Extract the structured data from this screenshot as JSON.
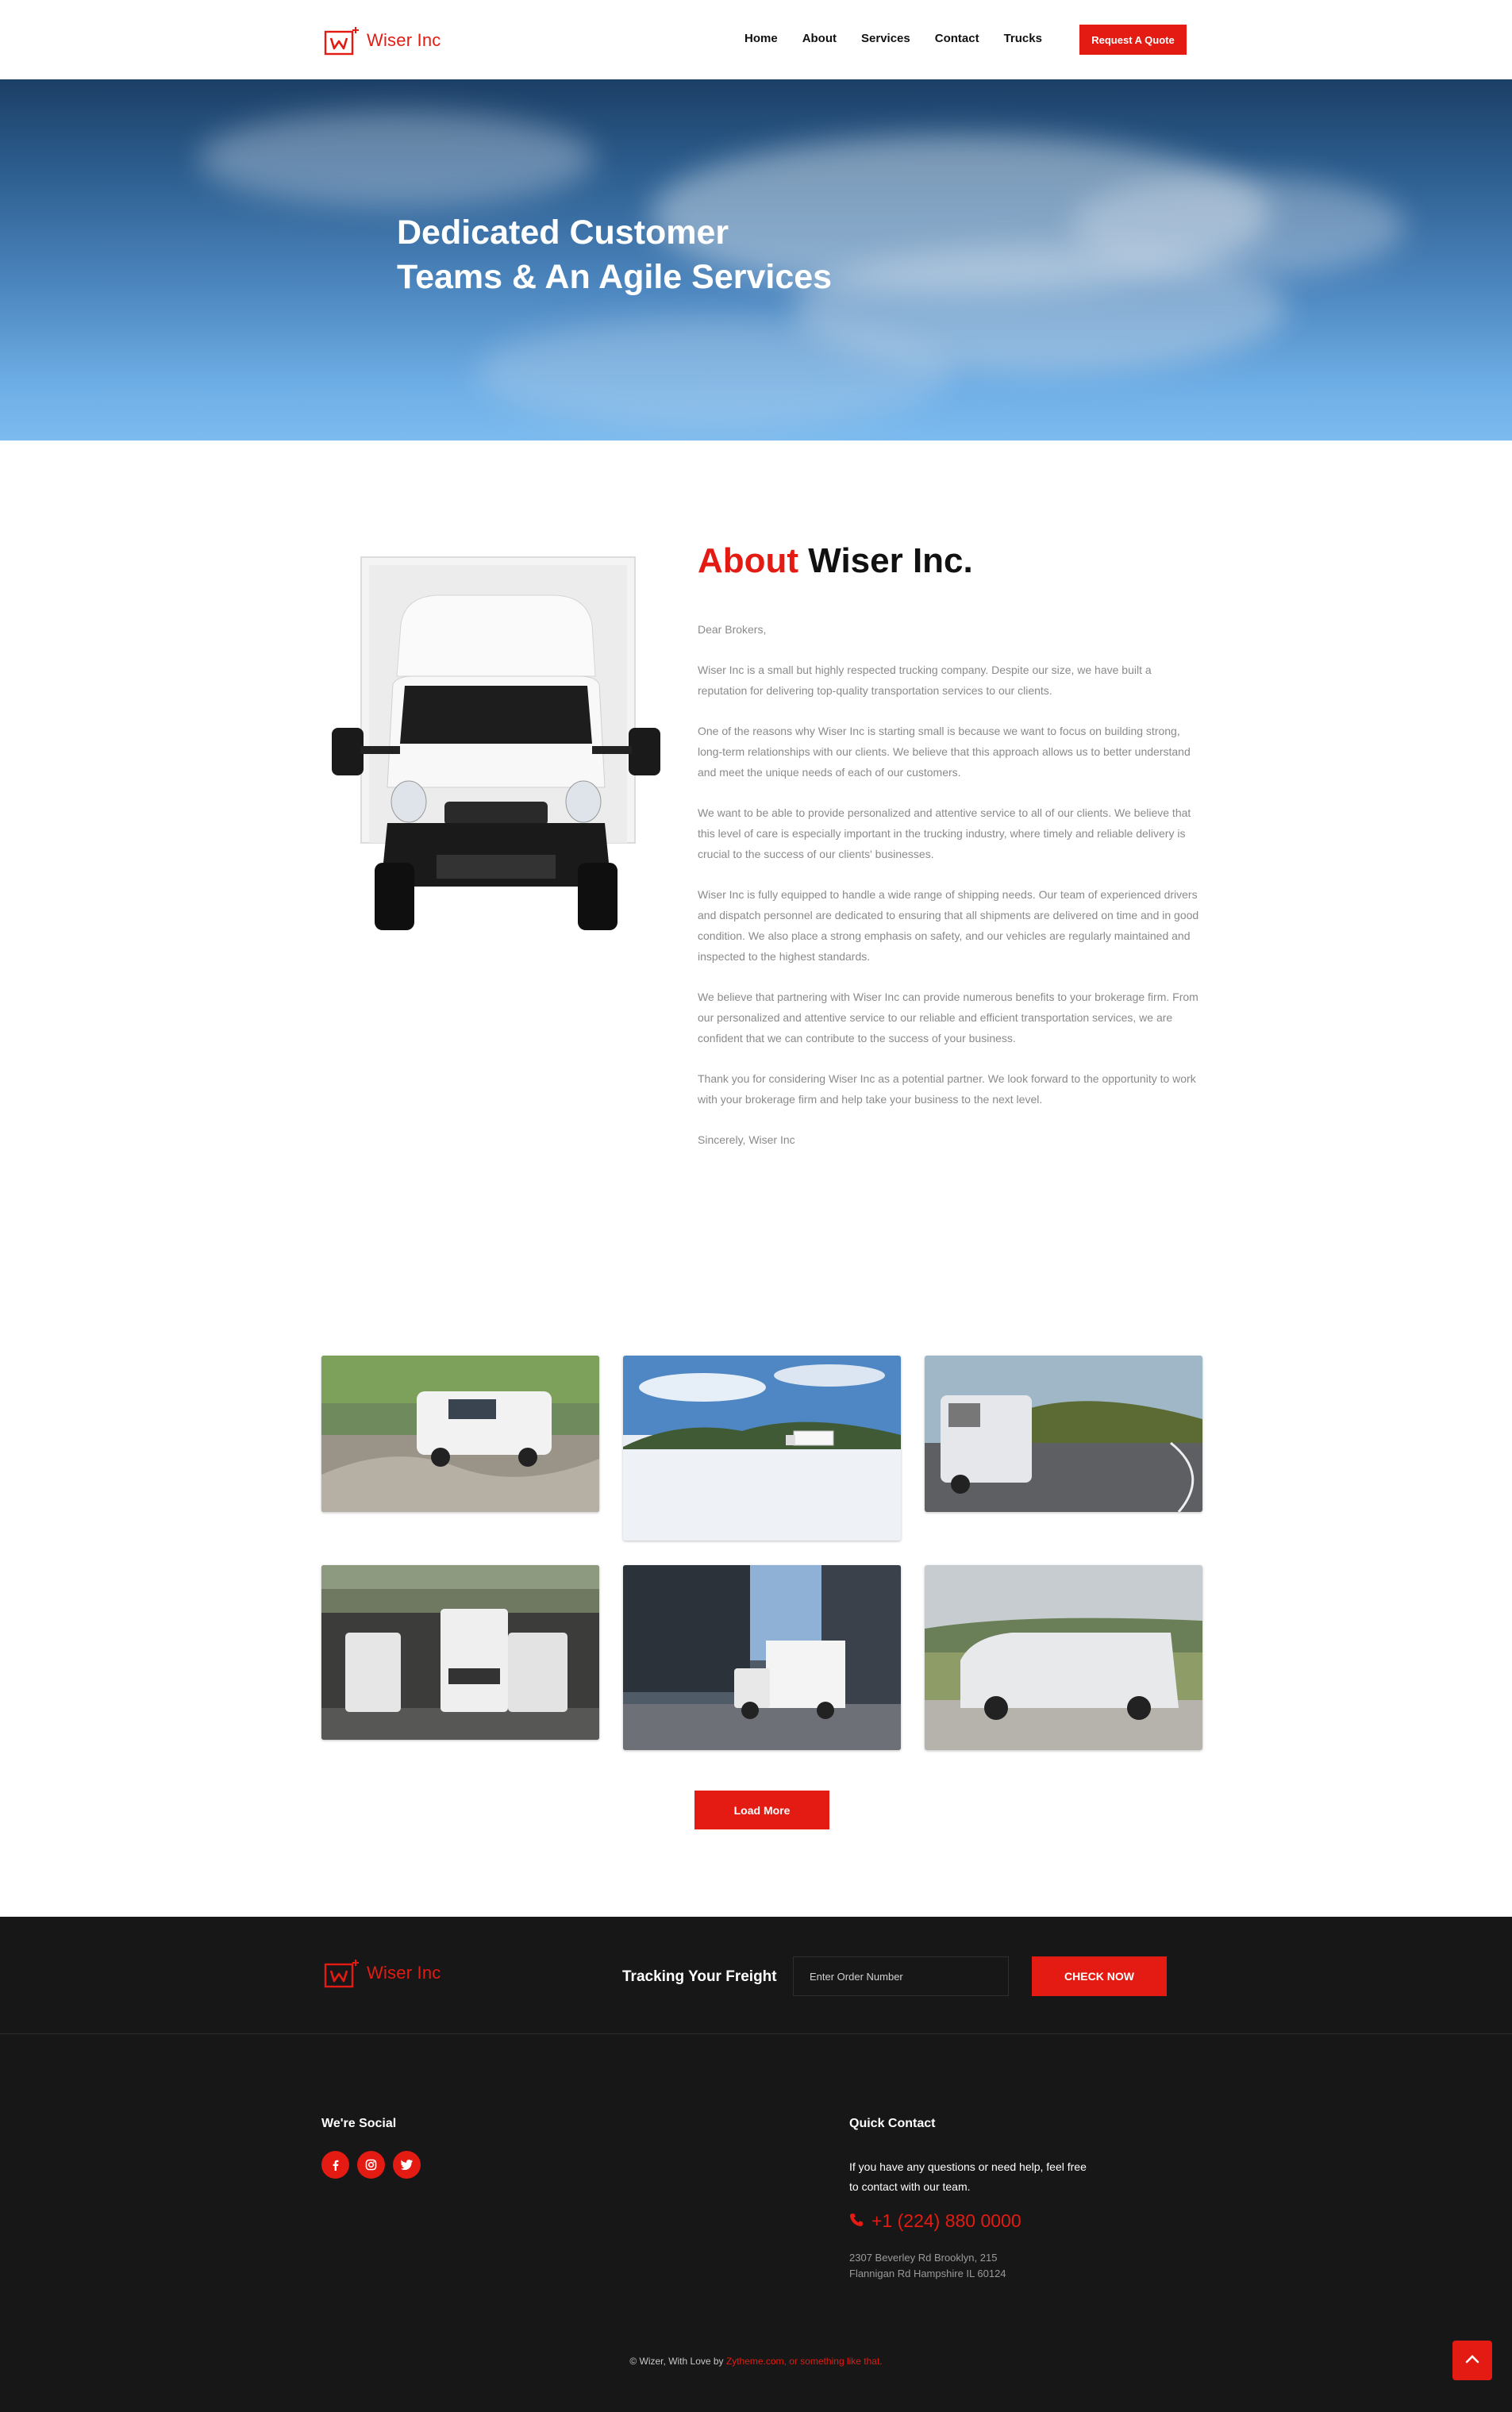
{
  "brand": {
    "name": "Wiser Inc"
  },
  "nav": {
    "items": [
      "Home",
      "About",
      "Services",
      "Contact",
      "Trucks"
    ],
    "quote_label": "Request A Quote"
  },
  "hero": {
    "line1": "Dedicated Customer",
    "line2": "Teams & An Agile Services"
  },
  "about": {
    "title_highlight": "About",
    "title_rest": "Wiser Inc.",
    "paragraphs": [
      "Dear Brokers,",
      "Wiser Inc is a small but highly respected trucking company. Despite our size, we have built a reputation for delivering top-quality transportation services to our clients.",
      "One of the reasons why Wiser Inc is starting small is because we want to focus on building strong, long-term relationships with our clients. We believe that this approach allows us to better understand and meet the unique needs of each of our customers.",
      "We want to be able to provide personalized and attentive service to all of our clients. We believe that this level of care is especially important in the trucking industry, where timely and reliable delivery is crucial to the success of our clients' businesses.",
      "Wiser Inc is fully equipped to handle a wide range of shipping needs. Our team of experienced drivers and dispatch personnel are dedicated to ensuring that all shipments are delivered on time and in good condition. We also place a strong emphasis on safety, and our vehicles are regularly maintained and inspected to the highest standards.",
      "We believe that partnering with Wiser Inc can provide numerous benefits to your brokerage firm. From our personalized and attentive service to our reliable and efficient transportation services, we are confident that we can contribute to the success of your business.",
      "Thank you for considering Wiser Inc as a potential partner. We look forward to the opportunity to work with your brokerage firm and help take your business to the next level.",
      "Sincerely, Wiser Inc"
    ]
  },
  "gallery": {
    "load_more_label": "Load More"
  },
  "tracking": {
    "label": "Tracking Your Freight",
    "placeholder": "Enter Order Number",
    "button_label": "CHECK NOW"
  },
  "footer": {
    "social_heading": "We're Social",
    "social_icons": [
      "facebook-icon",
      "instagram-icon",
      "twitter-icon"
    ],
    "contact_heading": "Quick Contact",
    "contact_text": "If you have any questions or need help, feel free to contact with our team.",
    "phone": "+1 (224) 880 0000",
    "address_line1": "2307 Beverley Rd Brooklyn, 215",
    "address_line2": "Flannigan Rd Hampshire IL 60124",
    "copyright_prefix": "© Wizer, With Love by ",
    "copyright_link": "Zytheme.com, or something like that."
  },
  "colors": {
    "accent": "#e31b12",
    "footer_bg": "#171717"
  }
}
